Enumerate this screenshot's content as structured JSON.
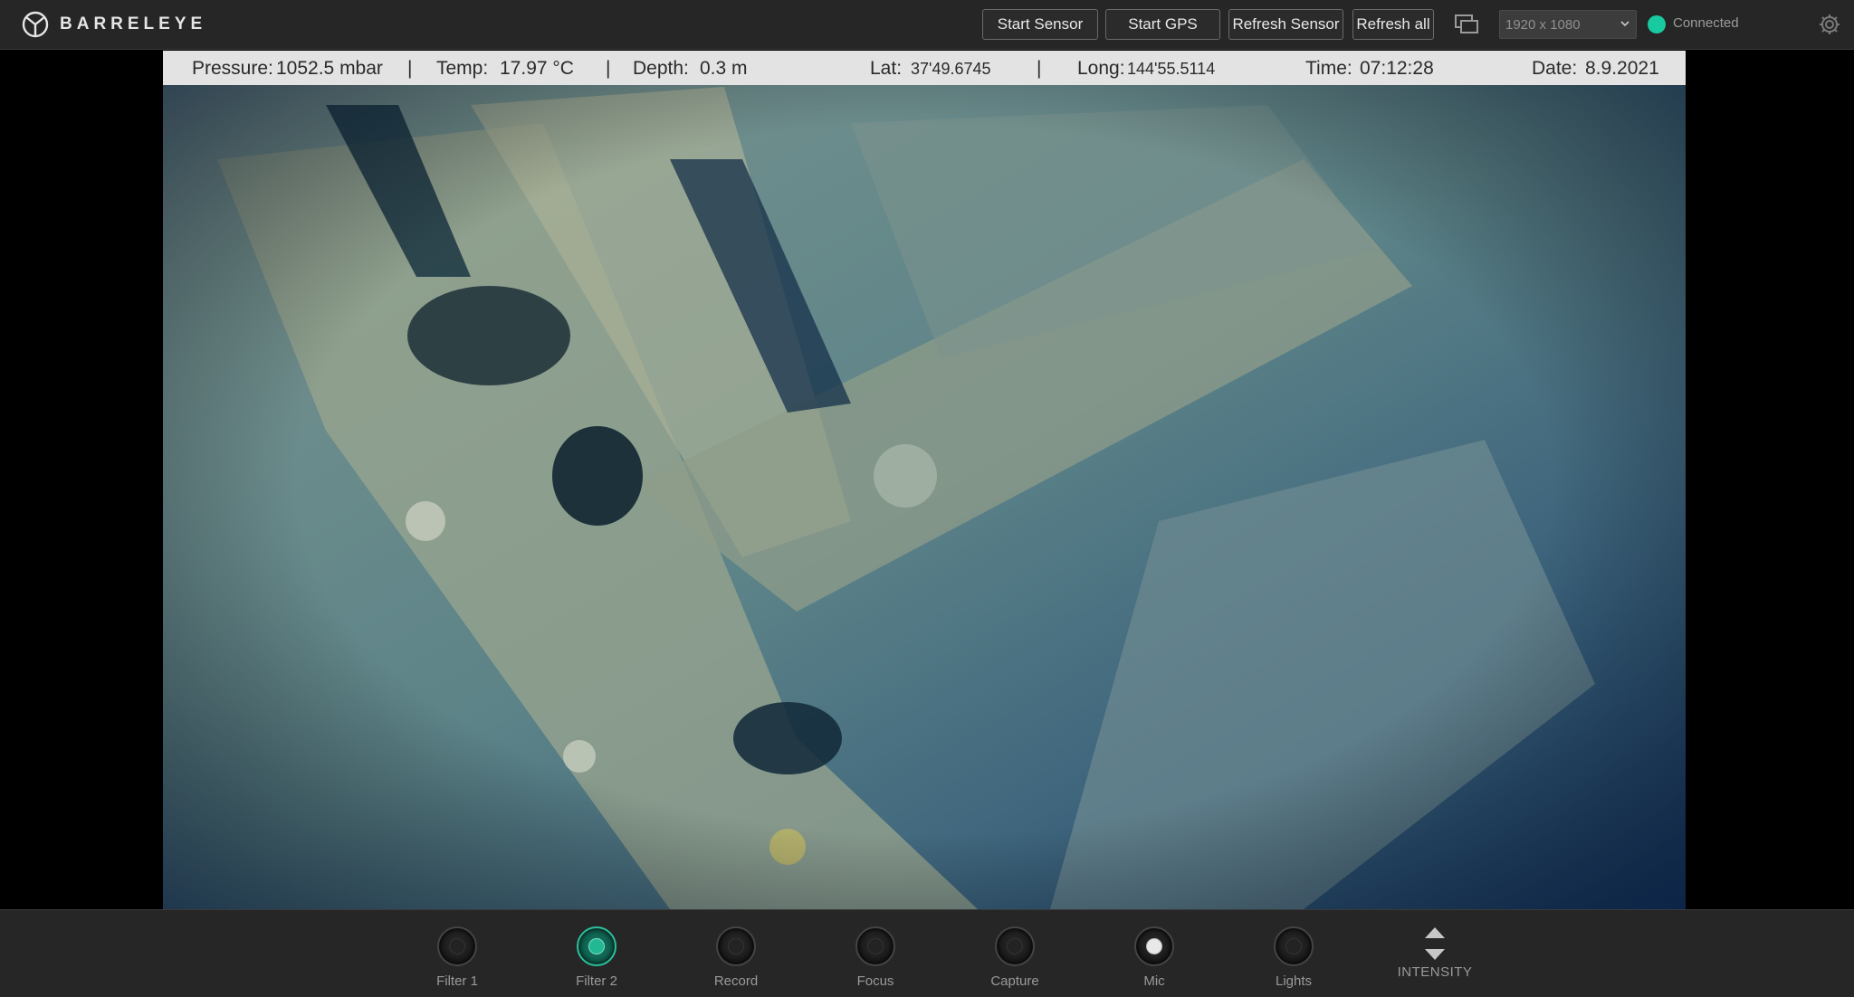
{
  "app": {
    "brand": "BARRELEYE"
  },
  "toolbar": {
    "start_sensor": "Start Sensor",
    "start_gps": "Start GPS",
    "refresh_sensor": "Refresh Sensor",
    "refresh_all": "Refresh all",
    "resolution_selected": "1920 x 1080",
    "connection_status": "Connected",
    "connection_color": "#19c9a0"
  },
  "telemetry": {
    "pressure_label": "Pressure:",
    "pressure_value": "1052.5 mbar",
    "temp_label": "Temp:",
    "temp_value": "17.97 °C",
    "depth_label": "Depth:",
    "depth_value": "0.3 m",
    "lat_label": "Lat:",
    "lat_value": "37'49.6745",
    "long_label": "Long:",
    "long_value": "144'55.5114",
    "time_label": "Time:",
    "time_value": "07:12:28",
    "date_label": "Date:",
    "date_value": "8.9.2021",
    "separator": "|"
  },
  "controls": [
    {
      "label": "Filter 1",
      "active": false
    },
    {
      "label": "Filter 2",
      "active": true
    },
    {
      "label": "Record",
      "active": false
    },
    {
      "label": "Focus",
      "active": false
    },
    {
      "label": "Capture",
      "active": false
    },
    {
      "label": "Mic",
      "active": false
    },
    {
      "label": "Lights",
      "active": false
    }
  ],
  "intensity": {
    "label": "INTENSITY"
  },
  "colors": {
    "accent": "#19c9a0",
    "topbar_bg": "#262626",
    "infobar_bg": "#e3e3e3"
  },
  "icons": {
    "logo": "barreleye-logo-icon",
    "screen": "screen-toggle-icon",
    "settings": "gear-icon",
    "intensity_up": "triangle-up-icon",
    "intensity_down": "triangle-down-icon"
  }
}
